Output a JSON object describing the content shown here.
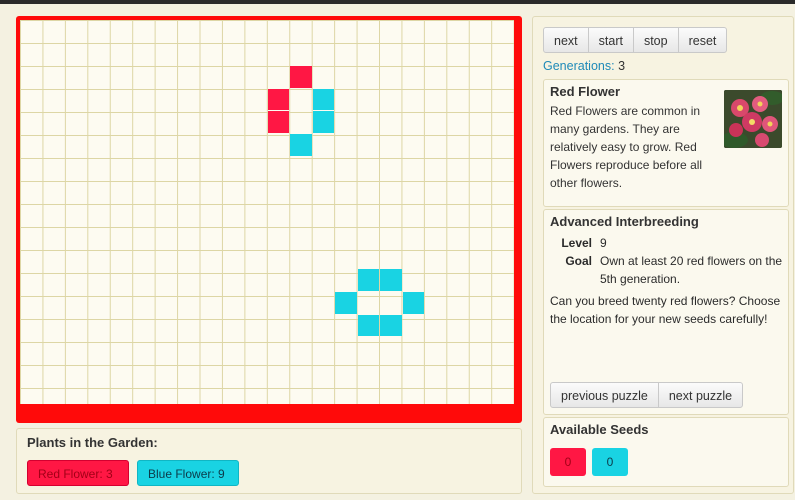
{
  "controls": {
    "next_label": "next",
    "start_label": "start",
    "stop_label": "stop",
    "reset_label": "reset"
  },
  "generations": {
    "label": "Generations:",
    "value": "3"
  },
  "flower": {
    "title": "Red Flower",
    "description": "Red Flowers are common in many gardens. They are relatively easy to grow. Red Flowers reproduce before all other flowers.",
    "image_icon": "red-begonia-photo"
  },
  "puzzle": {
    "title": "Advanced Interbreeding",
    "level_label": "Level",
    "level_value": "9",
    "goal_label": "Goal",
    "goal_value": "Own at least 20 red flowers on the 5th generation.",
    "description": "Can you breed twenty red flowers? Choose the location for your new seeds carefully!",
    "prev_label": "previous puzzle",
    "next_label": "next puzzle"
  },
  "seeds": {
    "title": "Available Seeds",
    "red_count": "0",
    "blue_count": "0"
  },
  "garden": {
    "title": "Plants in the Garden:",
    "red_label": "Red Flower: 3",
    "blue_label": "Blue Flower: 9"
  },
  "board": {
    "columns": 22,
    "rows": 17,
    "frame_color": "#ff0a0a",
    "cells": [
      {
        "col": 12,
        "row": 2,
        "color": "red"
      },
      {
        "col": 11,
        "row": 3,
        "color": "red"
      },
      {
        "col": 11,
        "row": 4,
        "color": "red"
      },
      {
        "col": 13,
        "row": 3,
        "color": "blue"
      },
      {
        "col": 13,
        "row": 4,
        "color": "blue"
      },
      {
        "col": 12,
        "row": 5,
        "color": "blue"
      },
      {
        "col": 15,
        "row": 11,
        "color": "blue"
      },
      {
        "col": 16,
        "row": 11,
        "color": "blue"
      },
      {
        "col": 14,
        "row": 12,
        "color": "blue"
      },
      {
        "col": 17,
        "row": 12,
        "color": "blue"
      },
      {
        "col": 15,
        "row": 13,
        "color": "blue"
      },
      {
        "col": 16,
        "row": 13,
        "color": "blue"
      }
    ]
  },
  "colors": {
    "red": "#ff1744",
    "blue": "#19d3e3",
    "accent": "#1f8ab8"
  }
}
